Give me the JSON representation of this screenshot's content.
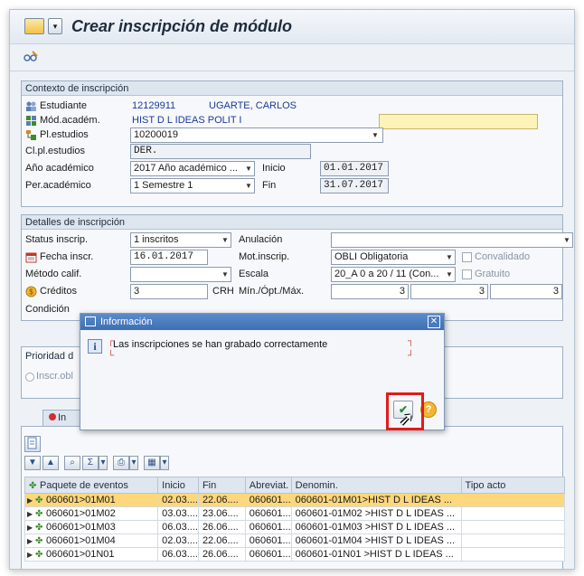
{
  "window": {
    "title": "Crear inscripción de módulo",
    "menu_dropdown": "▾"
  },
  "toolbar": {
    "tool_icon": "glasses-edit-icon"
  },
  "context": {
    "group_title": "Contexto de inscripción",
    "student_label": "Estudiante",
    "student_id": "12129911",
    "student_name": "UGARTE, CARLOS",
    "module_label": "Mód.académ.",
    "module_value": "HIST D L IDEAS POLIT I",
    "module_field": "",
    "plan_label": "Pl.estudios",
    "plan_value": "10200019",
    "clplan_label": "Cl.pl.estudios",
    "clplan_value": "DER.",
    "year_label": "Año académico",
    "year_value": "2017 Año académico ...",
    "start_label": "Inicio",
    "start_value": "01.01.2017",
    "period_label": "Per.académico",
    "period_value": "1 Semestre 1",
    "end_label": "Fin",
    "end_value": "31.07.2017"
  },
  "details": {
    "group_title": "Detalles de inscripción",
    "status_label": "Status inscrip.",
    "status_value": "1 inscritos",
    "cancel_label": "Anulación",
    "cancel_value": "",
    "date_label": "Fecha inscr.",
    "date_value": "16.01.2017",
    "reason_label": "Mot.inscrip.",
    "reason_value": "OBLI Obligatoria",
    "validated_label": "Convalidado",
    "method_label": "Método calif.",
    "method_value": "",
    "scale_label": "Escala",
    "scale_value": "20_A 0 a 20 / 11 (Con...",
    "free_label": "Gratuito",
    "credits_label": "Créditos",
    "credits_value": "3",
    "credits_unit": "CRH",
    "minmax_label": "Mín./Ópt./Máx.",
    "min_value": "3",
    "opt_value": "3",
    "max_value": "3",
    "condition_label": "Condición"
  },
  "priority": {
    "group_title": "Prioridad d",
    "radio_label": "Inscr.obl"
  },
  "dialog": {
    "title": "Información",
    "message": "Las inscripciones se han grabado correctamente",
    "close": "✕",
    "ok_icon": "✔",
    "help_icon": "?"
  },
  "tabs": {
    "first_tab": "In"
  },
  "table": {
    "headers": [
      "Paquete de eventos",
      "Inicio",
      "Fin",
      "Abreviat.",
      "Denomin.",
      "Tipo acto"
    ],
    "rows": [
      {
        "package": "060601>01M01",
        "start": "02.03....",
        "end": "22.06....",
        "abbr": "060601...",
        "name": "060601-01M01>HIST D L IDEAS ...",
        "type": ""
      },
      {
        "package": "060601>01M02",
        "start": "03.03....",
        "end": "23.06....",
        "abbr": "060601...",
        "name": "060601-01M02 >HIST D L IDEAS ...",
        "type": ""
      },
      {
        "package": "060601>01M03",
        "start": "06.03....",
        "end": "26.06....",
        "abbr": "060601...",
        "name": "060601-01M03 >HIST D L IDEAS ...",
        "type": ""
      },
      {
        "package": "060601>01M04",
        "start": "02.03....",
        "end": "22.06....",
        "abbr": "060601...",
        "name": "060601-01M04 >HIST D L IDEAS ...",
        "type": ""
      },
      {
        "package": "060601>01N01",
        "start": "06.03....",
        "end": "26.06....",
        "abbr": "060601...",
        "name": "060601-01N01 >HIST D L IDEAS ...",
        "type": ""
      }
    ]
  },
  "colors": {
    "highlight_row": "#fcd77c",
    "dialog_title": "#3d6fb2",
    "callout_border": "#e01b1b",
    "link_blue": "#1a3a9c"
  }
}
